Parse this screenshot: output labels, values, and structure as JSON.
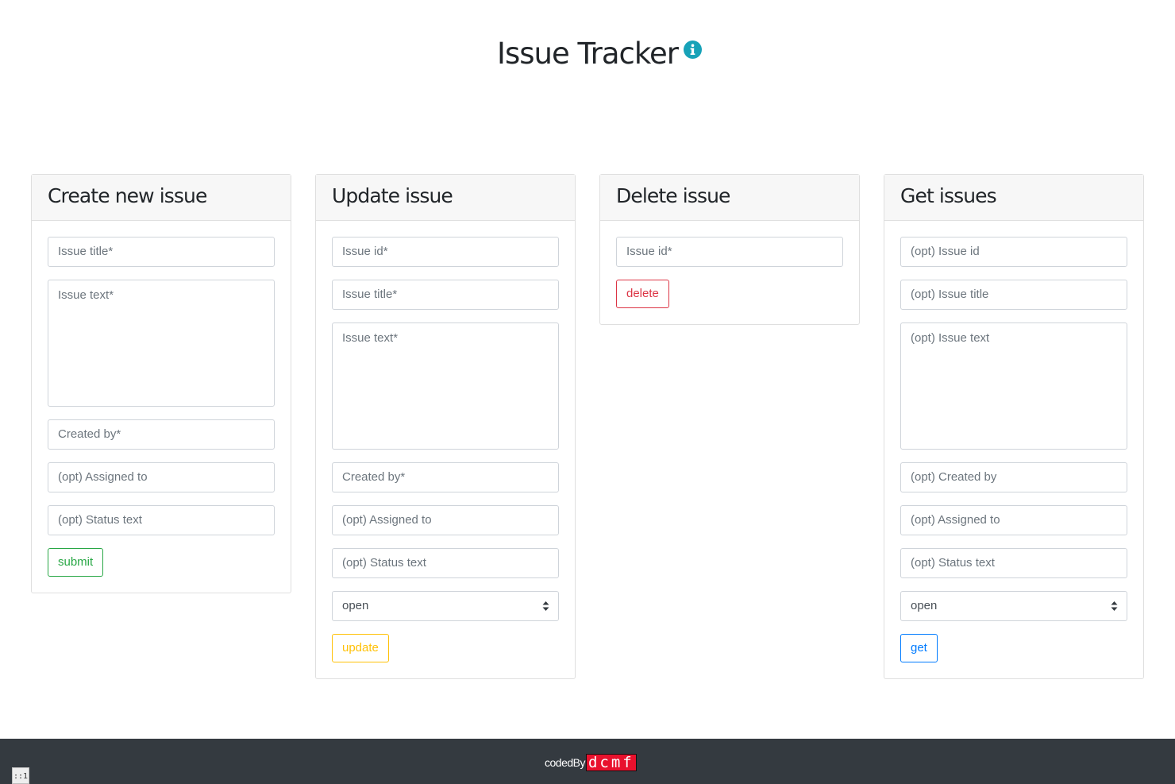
{
  "app": {
    "title": "Issue Tracker",
    "info_icon": "info-circle-icon",
    "accent_color": "#17a2b8"
  },
  "create": {
    "heading": "Create new issue",
    "title_placeholder": "Issue title*",
    "text_placeholder": "Issue text*",
    "created_by_placeholder": "Created by*",
    "assigned_to_placeholder": "(opt) Assigned to",
    "status_text_placeholder": "(opt) Status text",
    "button_label": "submit",
    "button_color": "#28a745"
  },
  "update": {
    "heading": "Update issue",
    "id_placeholder": "Issue id*",
    "title_placeholder": "Issue title*",
    "text_placeholder": "Issue text*",
    "created_by_placeholder": "Created by*",
    "assigned_to_placeholder": "(opt) Assigned to",
    "status_text_placeholder": "(opt) Status text",
    "status_selected": "open",
    "button_label": "update",
    "button_color": "#ffc107"
  },
  "delete": {
    "heading": "Delete issue",
    "id_placeholder": "Issue id*",
    "button_label": "delete",
    "button_color": "#dc3545"
  },
  "get": {
    "heading": "Get issues",
    "id_placeholder": "(opt) Issue id",
    "title_placeholder": "(opt) Issue title",
    "text_placeholder": "(opt) Issue text",
    "created_by_placeholder": "(opt) Created by",
    "assigned_to_placeholder": "(opt) Assigned to",
    "status_text_placeholder": "(opt) Status text",
    "status_selected": "open",
    "button_label": "get",
    "button_color": "#007bff"
  },
  "footer": {
    "credit_label": "codedBy",
    "brand": "dcmf",
    "background_color": "#343a40",
    "corner_tag": "::1"
  }
}
